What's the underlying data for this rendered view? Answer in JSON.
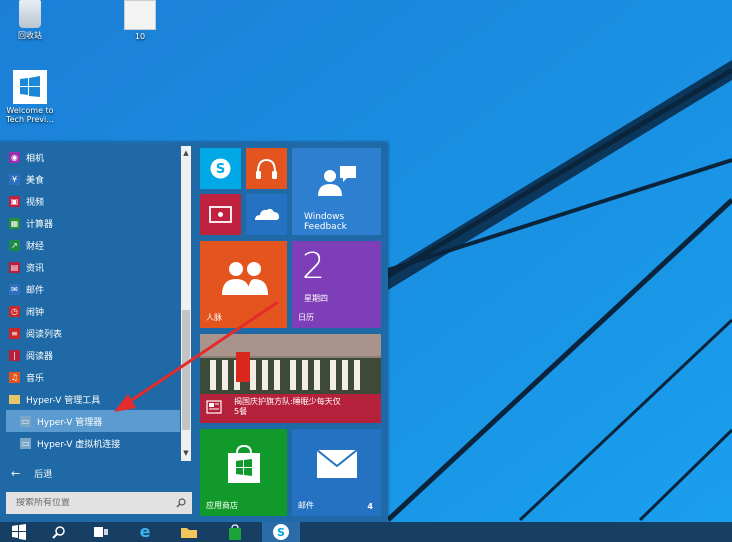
{
  "desktop": {
    "icons": [
      {
        "label": "回收站"
      },
      {
        "label": "10"
      },
      {
        "label_line1": "Welcome to",
        "label_line2": "Tech Previ..."
      }
    ]
  },
  "start_menu": {
    "apps": [
      {
        "label": "相机",
        "icon": "camera-icon",
        "color": "#9b2fae"
      },
      {
        "label": "美食",
        "icon": "food-icon",
        "color": "#2f6fbf"
      },
      {
        "label": "视频",
        "icon": "video-icon",
        "color": "#c0213f"
      },
      {
        "label": "计算器",
        "icon": "calculator-icon",
        "color": "#2a8a3e"
      },
      {
        "label": "财经",
        "icon": "finance-icon",
        "color": "#1e8a4a"
      },
      {
        "label": "资讯",
        "icon": "news-icon",
        "color": "#b5213a"
      },
      {
        "label": "邮件",
        "icon": "mail-icon",
        "color": "#2f6fbf"
      },
      {
        "label": "闹钟",
        "icon": "alarm-icon",
        "color": "#c8282b"
      },
      {
        "label": "阅读列表",
        "icon": "reading-list-icon",
        "color": "#c8282b"
      },
      {
        "label": "阅读器",
        "icon": "reader-icon",
        "color": "#b5213a"
      },
      {
        "label": "音乐",
        "icon": "music-icon",
        "color": "#e3541f"
      },
      {
        "label": "Hyper-V 管理工具",
        "icon": "folder-icon",
        "color": "#e8c56a"
      },
      {
        "label": "Hyper-V 管理器",
        "icon": "hyperv-manager-icon",
        "color": "#7aa7c7"
      },
      {
        "label": "Hyper-V 虚拟机连接",
        "icon": "hyperv-connect-icon",
        "color": "#7aa7c7"
      }
    ],
    "selected_index": 12,
    "back_label": "后退",
    "search_placeholder": "搜索所有位置"
  },
  "tiles": {
    "skype": {
      "icon": "skype-icon",
      "color": "#00a8e6"
    },
    "music": {
      "icon": "headphones-icon",
      "color": "#e3541f"
    },
    "video": {
      "icon": "video-icon",
      "color": "#c0213f"
    },
    "onedrive": {
      "icon": "onedrive-icon",
      "color": "#2672c2"
    },
    "windows_feedback": {
      "line1": "Windows",
      "line2": "Feedback",
      "icon": "feedback-icon",
      "color": "#2f7fd1"
    },
    "people": {
      "label": "人脉",
      "icon": "people-icon",
      "color": "#e3541f"
    },
    "calendar": {
      "label": "日历",
      "day": "2",
      "weekday": "星期四",
      "color": "#7d3eb8"
    },
    "news": {
      "headline_line1": "揭国庆护旗方队:睡眠少每天仅",
      "headline_line2": "5餐",
      "icon": "news-icon",
      "color": "#b5213a"
    },
    "store": {
      "label": "应用商店",
      "icon": "store-icon",
      "color": "#119a2b"
    },
    "mail": {
      "label": "邮件",
      "badge": "4",
      "icon": "mail-icon",
      "color": "#2672c2"
    }
  },
  "taskbar": {
    "items": [
      {
        "name": "start-button",
        "icon": "windows-icon"
      },
      {
        "name": "search-button",
        "icon": "search-icon"
      },
      {
        "name": "task-view-button",
        "icon": "task-view-icon"
      },
      {
        "name": "ie-button",
        "icon": "ie-icon"
      },
      {
        "name": "explorer-button",
        "icon": "folder-icon"
      },
      {
        "name": "store-button",
        "icon": "store-icon"
      },
      {
        "name": "skype-button",
        "icon": "skype-icon"
      }
    ]
  }
}
